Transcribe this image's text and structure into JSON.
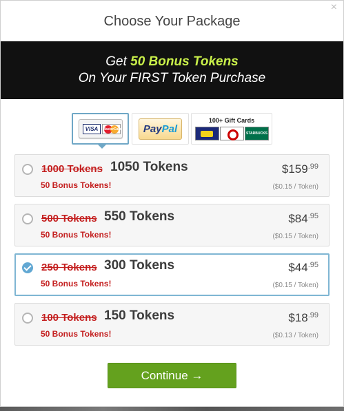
{
  "modal": {
    "title": "Choose Your Package",
    "close_glyph": "×"
  },
  "promo": {
    "line1_prefix": "Get ",
    "line1_highlight": "50 Bonus Tokens",
    "line2": "On Your FIRST Token Purchase",
    "highlight_color": "#c9f04a"
  },
  "payment_methods": {
    "selected": "credit-card",
    "credit_card": {
      "visa_label": "VISA",
      "mastercard_label": "MasterCard"
    },
    "paypal": {
      "label_part1": "Pay",
      "label_part2": "Pal"
    },
    "gift_cards": {
      "title": "100+ Gift Cards",
      "card3_label": "STARBUCKS"
    }
  },
  "packages": [
    {
      "old": "1000 Tokens",
      "new": "1050 Tokens",
      "bonus": "50 Bonus Tokens!",
      "price_main": "$159",
      "price_cents": ".99",
      "unit": "($0.15 / Token)",
      "selected": false
    },
    {
      "old": "500 Tokens",
      "new": "550 Tokens",
      "bonus": "50 Bonus Tokens!",
      "price_main": "$84",
      "price_cents": ".95",
      "unit": "($0.15 / Token)",
      "selected": false
    },
    {
      "old": "250 Tokens",
      "new": "300 Tokens",
      "bonus": "50 Bonus Tokens!",
      "price_main": "$44",
      "price_cents": ".95",
      "unit": "($0.15 / Token)",
      "selected": true
    },
    {
      "old": "100 Tokens",
      "new": "150 Tokens",
      "bonus": "50 Bonus Tokens!",
      "price_main": "$18",
      "price_cents": ".99",
      "unit": "($0.13 / Token)",
      "selected": false
    }
  ],
  "continue_label": "Continue →",
  "colors": {
    "accent_green": "#64a11e",
    "selected_blue": "#62a8d3",
    "bonus_red": "#c41f1f"
  }
}
